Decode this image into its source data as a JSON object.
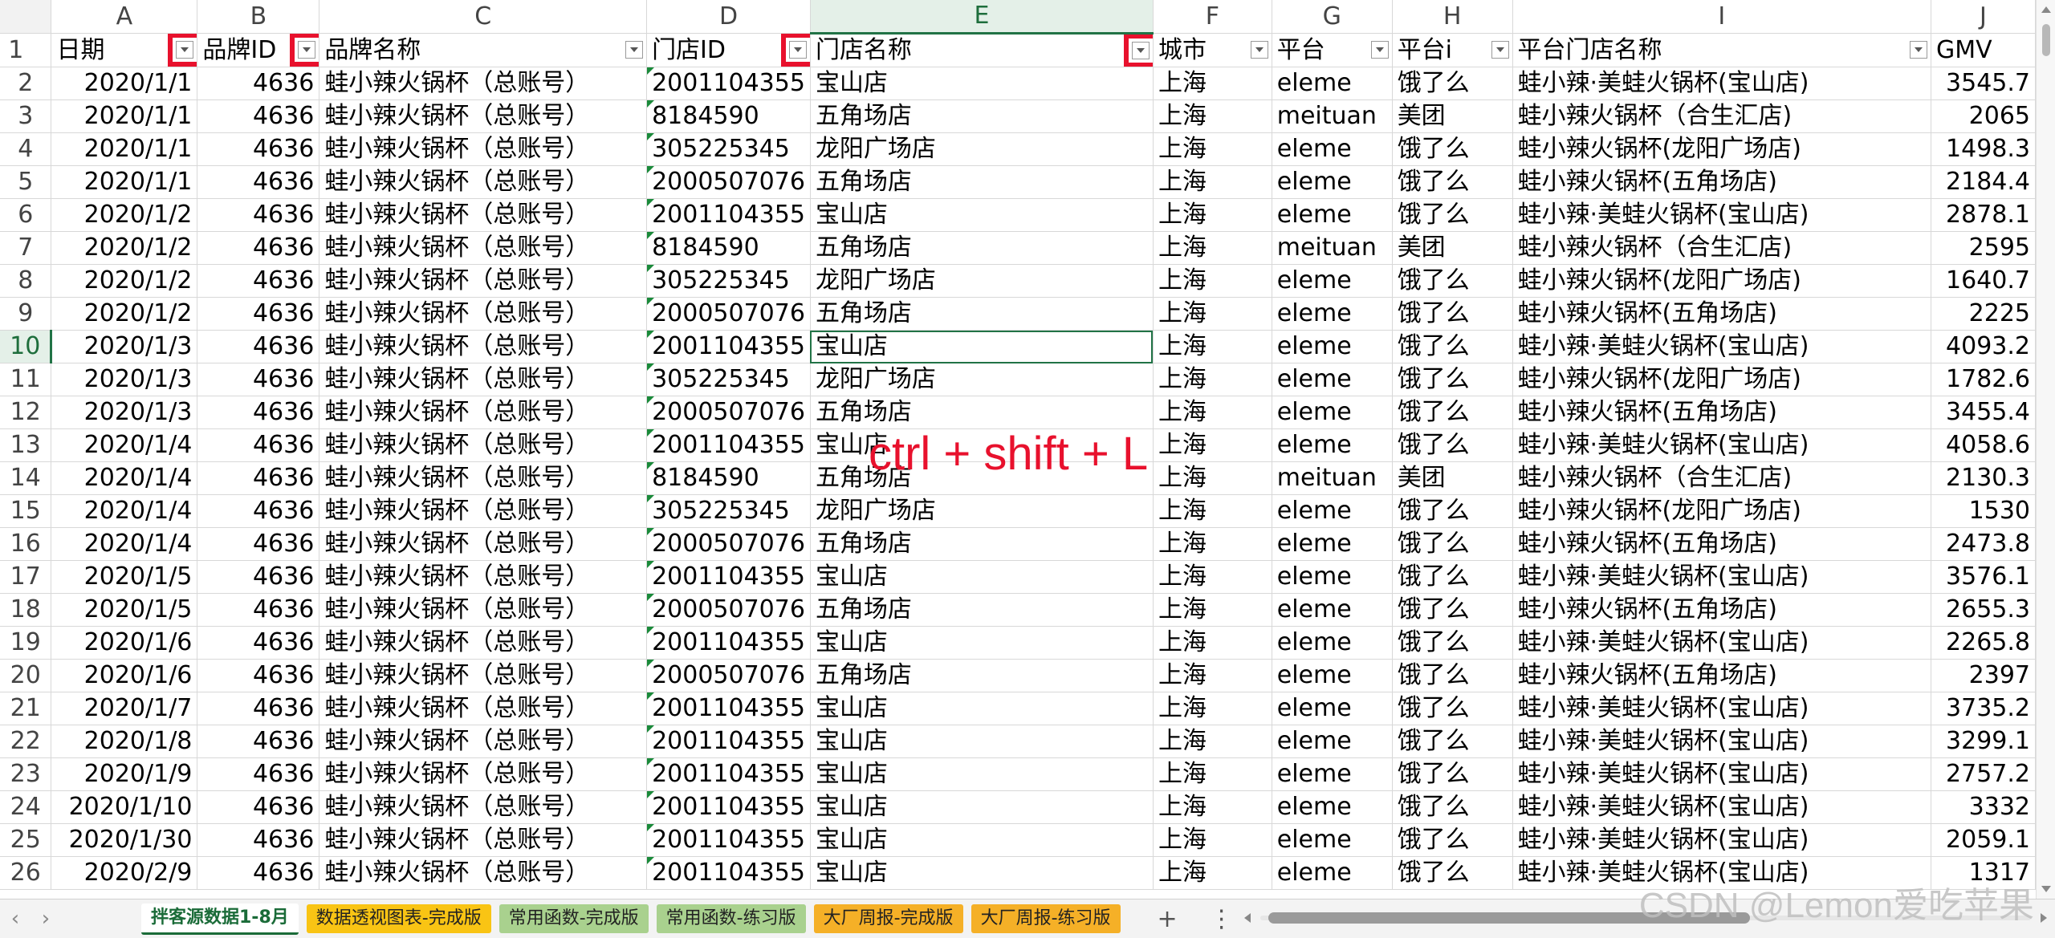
{
  "column_letters": [
    "A",
    "B",
    "C",
    "D",
    "E",
    "F",
    "G",
    "H",
    "I",
    "J"
  ],
  "active_column": "E",
  "active_row": 10,
  "headers": [
    "日期",
    "品牌ID",
    "品牌名称",
    "门店ID",
    "门店名称",
    "城市",
    "平台",
    "平台i",
    "平台门店名称",
    "GMV"
  ],
  "highlighted_filters": [
    0,
    1,
    3,
    4
  ],
  "rows": [
    [
      "2020/1/1",
      "4636",
      "蛙小辣火锅杯（总账号）",
      "2001104355",
      "宝山店",
      "上海",
      "eleme",
      "饿了么",
      "蛙小辣·美蛙火锅杯(宝山店)",
      "3545.7"
    ],
    [
      "2020/1/1",
      "4636",
      "蛙小辣火锅杯（总账号）",
      "8184590",
      "五角场店",
      "上海",
      "meituan",
      "美团",
      "蛙小辣火锅杯（合生汇店)",
      "2065"
    ],
    [
      "2020/1/1",
      "4636",
      "蛙小辣火锅杯（总账号）",
      "305225345",
      "龙阳广场店",
      "上海",
      "eleme",
      "饿了么",
      "蛙小辣火锅杯(龙阳广场店)",
      "1498.3"
    ],
    [
      "2020/1/1",
      "4636",
      "蛙小辣火锅杯（总账号）",
      "2000507076",
      "五角场店",
      "上海",
      "eleme",
      "饿了么",
      "蛙小辣火锅杯(五角场店)",
      "2184.4"
    ],
    [
      "2020/1/2",
      "4636",
      "蛙小辣火锅杯（总账号）",
      "2001104355",
      "宝山店",
      "上海",
      "eleme",
      "饿了么",
      "蛙小辣·美蛙火锅杯(宝山店)",
      "2878.1"
    ],
    [
      "2020/1/2",
      "4636",
      "蛙小辣火锅杯（总账号）",
      "8184590",
      "五角场店",
      "上海",
      "meituan",
      "美团",
      "蛙小辣火锅杯（合生汇店)",
      "2595"
    ],
    [
      "2020/1/2",
      "4636",
      "蛙小辣火锅杯（总账号）",
      "305225345",
      "龙阳广场店",
      "上海",
      "eleme",
      "饿了么",
      "蛙小辣火锅杯(龙阳广场店)",
      "1640.7"
    ],
    [
      "2020/1/2",
      "4636",
      "蛙小辣火锅杯（总账号）",
      "2000507076",
      "五角场店",
      "上海",
      "eleme",
      "饿了么",
      "蛙小辣火锅杯(五角场店)",
      "2225"
    ],
    [
      "2020/1/3",
      "4636",
      "蛙小辣火锅杯（总账号）",
      "2001104355",
      "宝山店",
      "上海",
      "eleme",
      "饿了么",
      "蛙小辣·美蛙火锅杯(宝山店)",
      "4093.2"
    ],
    [
      "2020/1/3",
      "4636",
      "蛙小辣火锅杯（总账号）",
      "305225345",
      "龙阳广场店",
      "上海",
      "eleme",
      "饿了么",
      "蛙小辣火锅杯(龙阳广场店)",
      "1782.6"
    ],
    [
      "2020/1/3",
      "4636",
      "蛙小辣火锅杯（总账号）",
      "2000507076",
      "五角场店",
      "上海",
      "eleme",
      "饿了么",
      "蛙小辣火锅杯(五角场店)",
      "3455.4"
    ],
    [
      "2020/1/4",
      "4636",
      "蛙小辣火锅杯（总账号）",
      "2001104355",
      "宝山店",
      "上海",
      "eleme",
      "饿了么",
      "蛙小辣·美蛙火锅杯(宝山店)",
      "4058.6"
    ],
    [
      "2020/1/4",
      "4636",
      "蛙小辣火锅杯（总账号）",
      "8184590",
      "五角场店",
      "上海",
      "meituan",
      "美团",
      "蛙小辣火锅杯（合生汇店)",
      "2130.3"
    ],
    [
      "2020/1/4",
      "4636",
      "蛙小辣火锅杯（总账号）",
      "305225345",
      "龙阳广场店",
      "上海",
      "eleme",
      "饿了么",
      "蛙小辣火锅杯(龙阳广场店)",
      "1530"
    ],
    [
      "2020/1/4",
      "4636",
      "蛙小辣火锅杯（总账号）",
      "2000507076",
      "五角场店",
      "上海",
      "eleme",
      "饿了么",
      "蛙小辣火锅杯(五角场店)",
      "2473.8"
    ],
    [
      "2020/1/5",
      "4636",
      "蛙小辣火锅杯（总账号）",
      "2001104355",
      "宝山店",
      "上海",
      "eleme",
      "饿了么",
      "蛙小辣·美蛙火锅杯(宝山店)",
      "3576.1"
    ],
    [
      "2020/1/5",
      "4636",
      "蛙小辣火锅杯（总账号）",
      "2000507076",
      "五角场店",
      "上海",
      "eleme",
      "饿了么",
      "蛙小辣火锅杯(五角场店)",
      "2655.3"
    ],
    [
      "2020/1/6",
      "4636",
      "蛙小辣火锅杯（总账号）",
      "2001104355",
      "宝山店",
      "上海",
      "eleme",
      "饿了么",
      "蛙小辣·美蛙火锅杯(宝山店)",
      "2265.8"
    ],
    [
      "2020/1/6",
      "4636",
      "蛙小辣火锅杯（总账号）",
      "2000507076",
      "五角场店",
      "上海",
      "eleme",
      "饿了么",
      "蛙小辣火锅杯(五角场店)",
      "2397"
    ],
    [
      "2020/1/7",
      "4636",
      "蛙小辣火锅杯（总账号）",
      "2001104355",
      "宝山店",
      "上海",
      "eleme",
      "饿了么",
      "蛙小辣·美蛙火锅杯(宝山店)",
      "3735.2"
    ],
    [
      "2020/1/8",
      "4636",
      "蛙小辣火锅杯（总账号）",
      "2001104355",
      "宝山店",
      "上海",
      "eleme",
      "饿了么",
      "蛙小辣·美蛙火锅杯(宝山店)",
      "3299.1"
    ],
    [
      "2020/1/9",
      "4636",
      "蛙小辣火锅杯（总账号）",
      "2001104355",
      "宝山店",
      "上海",
      "eleme",
      "饿了么",
      "蛙小辣·美蛙火锅杯(宝山店)",
      "2757.2"
    ],
    [
      "2020/1/10",
      "4636",
      "蛙小辣火锅杯（总账号）",
      "2001104355",
      "宝山店",
      "上海",
      "eleme",
      "饿了么",
      "蛙小辣·美蛙火锅杯(宝山店)",
      "3332"
    ],
    [
      "2020/1/30",
      "4636",
      "蛙小辣火锅杯（总账号）",
      "2001104355",
      "宝山店",
      "上海",
      "eleme",
      "饿了么",
      "蛙小辣·美蛙火锅杯(宝山店)",
      "2059.1"
    ],
    [
      "2020/2/9",
      "4636",
      "蛙小辣火锅杯（总账号）",
      "2001104355",
      "宝山店",
      "上海",
      "eleme",
      "饿了么",
      "蛙小辣·美蛙火锅杯(宝山店)",
      "1317"
    ]
  ],
  "shortcut_overlay": "ctrl + shift + L",
  "sheet_tabs": [
    {
      "label": "拌客源数据1-8月",
      "style": "active"
    },
    {
      "label": "数据透视图表-完成版",
      "style": "yellow"
    },
    {
      "label": "常用函数-完成版",
      "style": "green"
    },
    {
      "label": "常用函数-练习版",
      "style": "green"
    },
    {
      "label": "大厂周报-完成版",
      "style": "orange"
    },
    {
      "label": "大厂周报-练习版",
      "style": "orange"
    }
  ],
  "tab_controls": {
    "prev": "‹",
    "next": "›",
    "add": "+",
    "more": "⋮"
  },
  "watermark": "CSDN @Lemon爱吃苹果",
  "colors": {
    "accent_green": "#217346",
    "filter_highlight": "#e8112d",
    "header_bg": "#e4f0e8"
  }
}
